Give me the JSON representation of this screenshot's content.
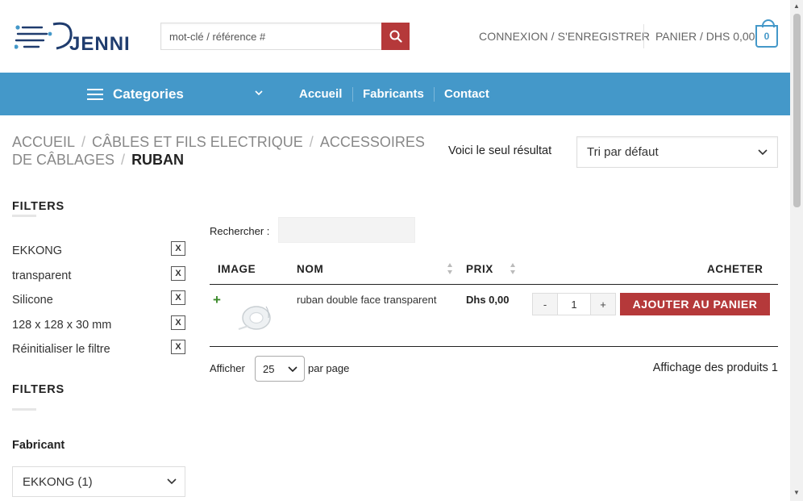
{
  "header": {
    "brand": "JENNI",
    "search_placeholder": "mot-clé / référence #",
    "account_label": "CONNEXION / S'ENREGISTRER",
    "cart_label": "PANIER / DHS 0,00",
    "cart_count": "0"
  },
  "nav": {
    "categories_label": "Categories",
    "items": [
      "Accueil",
      "Fabricants",
      "Contact"
    ]
  },
  "breadcrumb": {
    "items": [
      "ACCUEIL",
      "CÂBLES ET FILS ELECTRIQUE",
      "ACCESSOIRES DE CÂBLAGES"
    ],
    "current": "RUBAN"
  },
  "results": {
    "text": "Voici le seul résultat",
    "sort_selected": "Tri par défaut"
  },
  "sidebar": {
    "filters_title": "FILTERS",
    "active_filters": [
      "EKKONG",
      "transparent",
      "Silicone",
      "128 x 128 x 30 mm",
      "Réinitialiser le filtre"
    ],
    "remove_label": "X",
    "filters_title_2": "FILTERS",
    "manufacturer_title": "Fabricant",
    "manufacturer_selected": "EKKONG (1)"
  },
  "table": {
    "search_label": "Rechercher :",
    "headers": {
      "image": "IMAGE",
      "name": "NOM",
      "price": "PRIX",
      "buy": "ACHETER"
    },
    "rows": [
      {
        "name": "ruban double face transparent",
        "price": "Dhs 0,00",
        "qty": "1"
      }
    ],
    "qty_minus": "-",
    "qty_plus": "+",
    "add_to_cart": "AJOUTER AU PANIER",
    "show_label": "Afficher",
    "per_page_value": "25",
    "per_page_label": "par page",
    "showing": "Affichage des produits 1"
  },
  "colors": {
    "nav_blue": "#4498c9",
    "accent_red": "#b5393a",
    "plus_green": "#3b8a2a"
  }
}
